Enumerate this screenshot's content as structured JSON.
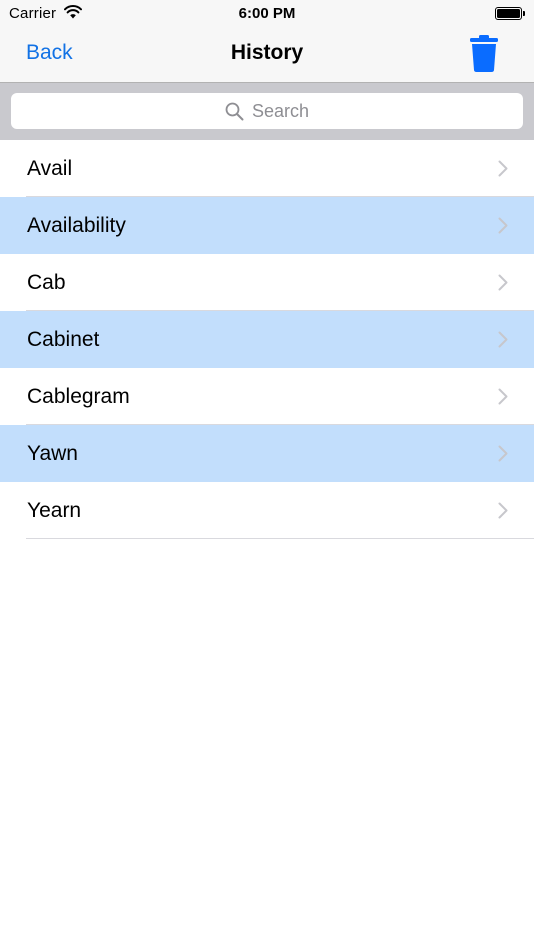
{
  "status_bar": {
    "carrier": "Carrier",
    "time": "6:00 PM",
    "icons": [
      "wifi-icon",
      "battery-icon"
    ]
  },
  "nav": {
    "back_label": "Back",
    "title": "History",
    "trash_icon": "trash-icon"
  },
  "search": {
    "placeholder": "Search",
    "icon": "magnifier-icon"
  },
  "history": {
    "items": [
      {
        "label": "Avail",
        "highlighted": false
      },
      {
        "label": "Availability",
        "highlighted": true
      },
      {
        "label": "Cab",
        "highlighted": false
      },
      {
        "label": "Cabinet",
        "highlighted": true
      },
      {
        "label": "Cablegram",
        "highlighted": false
      },
      {
        "label": "Yawn",
        "highlighted": true
      },
      {
        "label": "Yearn",
        "highlighted": false
      }
    ]
  },
  "colors": {
    "accent": "#1272e5",
    "trash": "#0a6cff",
    "row_highlight": "#c2defc",
    "search_bar_bg": "#c9c9ce",
    "nav_bg": "#f7f7f7"
  }
}
